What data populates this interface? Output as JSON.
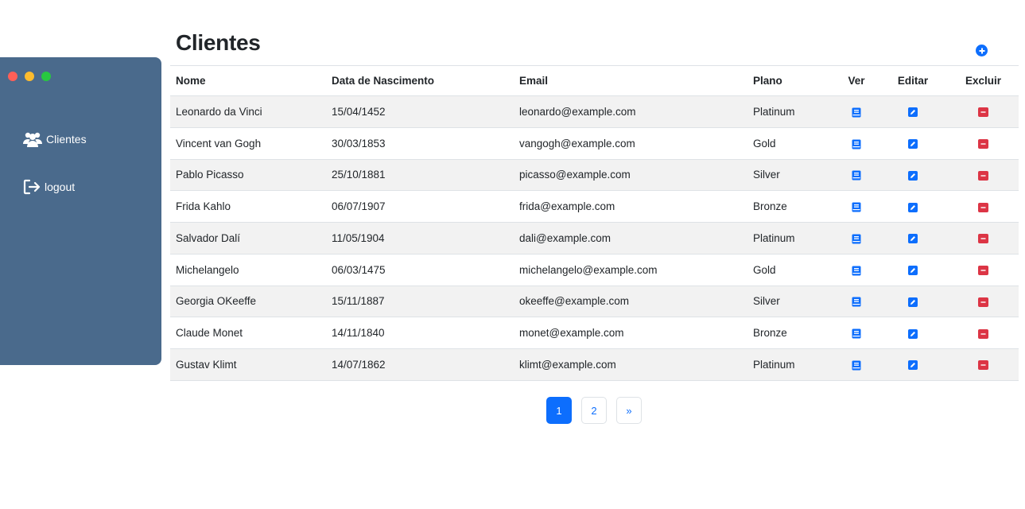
{
  "window_controls": {
    "colors": [
      "#ff5f57",
      "#febc2e",
      "#28c840"
    ]
  },
  "sidebar": {
    "items": [
      {
        "label": "Clientes",
        "icon": "users-icon"
      },
      {
        "label": "logout",
        "icon": "logout-icon"
      }
    ]
  },
  "page": {
    "title": "Clientes",
    "add_button_icon": "plus-circle-icon"
  },
  "table": {
    "headers": [
      "Nome",
      "Data de Nascimento",
      "Email",
      "Plano",
      "Ver",
      "Editar",
      "Excluir"
    ],
    "rows": [
      {
        "nome": "Leonardo da Vinci",
        "nascimento": "15/04/1452",
        "email": "leonardo@example.com",
        "plano": "Platinum"
      },
      {
        "nome": "Vincent van Gogh",
        "nascimento": "30/03/1853",
        "email": "vangogh@example.com",
        "plano": "Gold"
      },
      {
        "nome": "Pablo Picasso",
        "nascimento": "25/10/1881",
        "email": "picasso@example.com",
        "plano": "Silver"
      },
      {
        "nome": "Frida Kahlo",
        "nascimento": "06/07/1907",
        "email": "frida@example.com",
        "plano": "Bronze"
      },
      {
        "nome": "Salvador Dalí",
        "nascimento": "11/05/1904",
        "email": "dali@example.com",
        "plano": "Platinum"
      },
      {
        "nome": "Michelangelo",
        "nascimento": "06/03/1475",
        "email": "michelangelo@example.com",
        "plano": "Gold"
      },
      {
        "nome": "Georgia OKeeffe",
        "nascimento": "15/11/1887",
        "email": "okeeffe@example.com",
        "plano": "Silver"
      },
      {
        "nome": "Claude Monet",
        "nascimento": "14/11/1840",
        "email": "monet@example.com",
        "plano": "Bronze"
      },
      {
        "nome": "Gustav Klimt",
        "nascimento": "14/07/1862",
        "email": "klimt@example.com",
        "plano": "Platinum"
      }
    ],
    "action_icons": {
      "ver": "book-icon",
      "editar": "pencil-square-icon",
      "excluir": "dash-square-icon"
    },
    "action_colors": {
      "ver": "#0d6efd",
      "editar": "#0d6efd",
      "excluir": "#dc3545"
    }
  },
  "pagination": {
    "pages": [
      "1",
      "2"
    ],
    "active": "1",
    "next": "»"
  },
  "colors": {
    "sidebar_bg": "#4a6a8c",
    "primary": "#0d6efd",
    "danger": "#dc3545",
    "row_stripe": "#f2f2f2"
  }
}
